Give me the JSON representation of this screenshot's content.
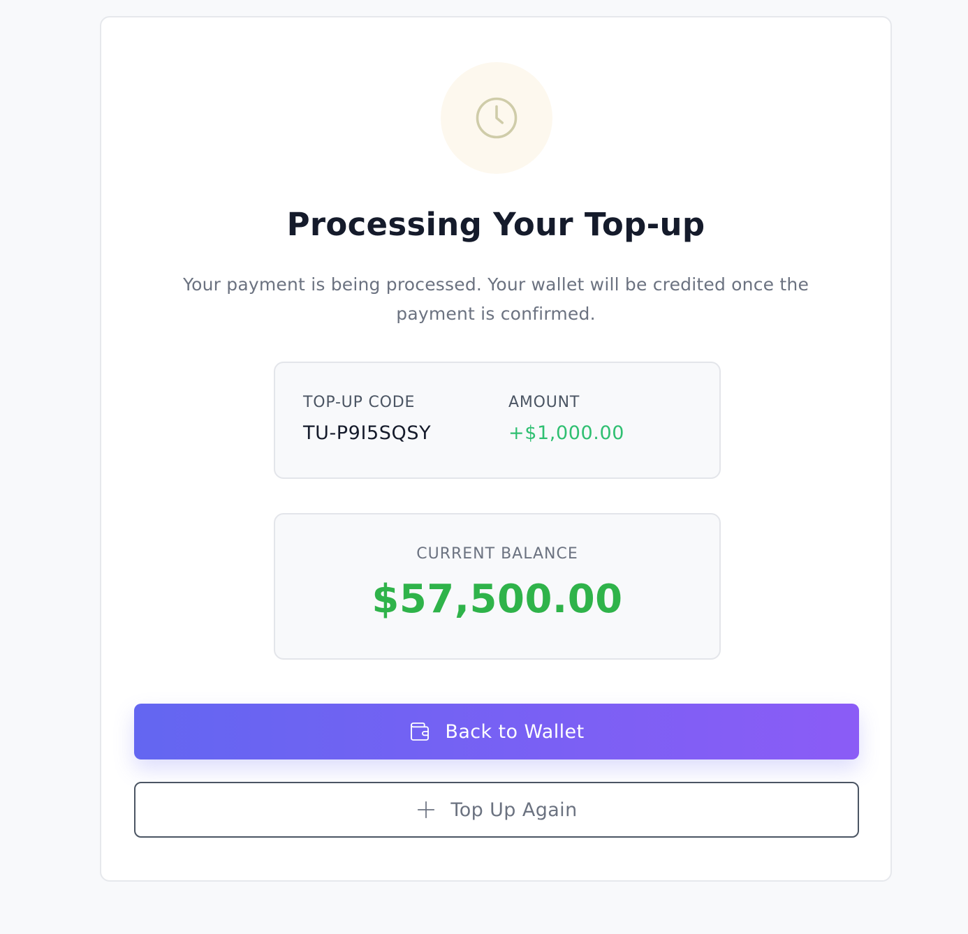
{
  "status": {
    "icon": "clock-icon",
    "title": "Processing Your Top-up",
    "message": "Your payment is being processed. Your wallet will be credited once the payment is confirmed."
  },
  "details": {
    "code_label": "TOP-UP CODE",
    "code_value": "TU-P9I5SQSY",
    "amount_label": "AMOUNT",
    "amount_value": "+$1,000.00"
  },
  "balance": {
    "label": "CURRENT BALANCE",
    "value": "$57,500.00"
  },
  "actions": {
    "back_label": "Back to Wallet",
    "back_icon": "wallet-icon",
    "topup_label": "Top Up Again",
    "topup_icon": "plus-icon"
  },
  "colors": {
    "primary_start": "#6366f1",
    "primary_end": "#8b5cf6",
    "positive": "#2fbf71",
    "balance": "#2fb34a",
    "pending_bg": "#fdf8ee"
  }
}
